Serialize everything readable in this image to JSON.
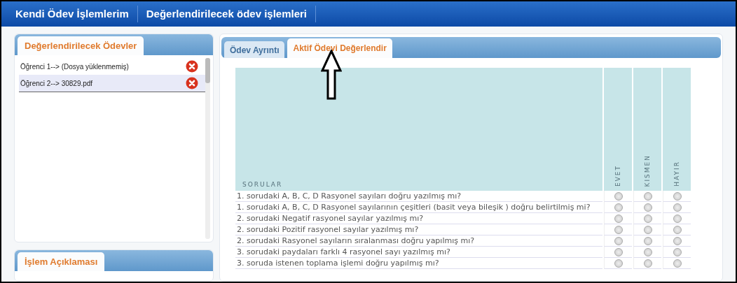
{
  "nav": [
    "Kendi Ödev İşlemlerim",
    "Değerlendirilecek ödev işlemleri"
  ],
  "assignments_panel": {
    "title": "Değerlendirilecek Ödevler",
    "items": [
      {
        "label": "Öğrenci 1--> (Dosya yüklenmemiş)",
        "selected": false
      },
      {
        "label": "Öğrenci 2--> 30829.pdf",
        "selected": true
      }
    ]
  },
  "description_panel": {
    "title": "İşlem Açıklaması"
  },
  "tabs": [
    {
      "label": "Ödev Ayrıntı",
      "selected": false
    },
    {
      "label": "Aktif Ödevi Değerlendir",
      "selected": true
    }
  ],
  "table": {
    "columns": [
      "SORULAR",
      "EVET",
      "KISMEN",
      "HAYIR"
    ],
    "rows": [
      {
        "question": "1. sorudaki A, B, C, D Rasyonel sayıları doğru yazılmış mı?",
        "choices": [
          {
            "selected": false
          },
          {
            "selected": false
          },
          {
            "selected": false
          }
        ]
      },
      {
        "question": "1. sorudaki A, B, C, D Rasyonel sayılarının çeşitleri (basit veya bileşik ) doğru belirtilmiş mi?",
        "choices": [
          {
            "selected": false
          },
          {
            "selected": false
          },
          {
            "selected": false
          }
        ]
      },
      {
        "question": "2. sorudaki Negatif rasyonel sayılar yazılmış mı?",
        "choices": [
          {
            "selected": false
          },
          {
            "selected": false
          },
          {
            "selected": false
          }
        ]
      },
      {
        "question": "2. sorudaki Pozitif rasyonel sayılar yazılmış mı?",
        "choices": [
          {
            "selected": false
          },
          {
            "selected": false
          },
          {
            "selected": false
          }
        ]
      },
      {
        "question": "2. sorudaki Rasyonel sayıların sıralanması doğru yapılmış mı?",
        "choices": [
          {
            "selected": false
          },
          {
            "selected": false
          },
          {
            "selected": false
          }
        ]
      },
      {
        "question": "3. sorudaki paydaları farklı 4 rasyonel sayı yazılmış mı?",
        "choices": [
          {
            "selected": false
          },
          {
            "selected": false
          },
          {
            "selected": false
          }
        ]
      },
      {
        "question": "3. soruda istenen toplama işlemi doğru yapılmış mı?",
        "choices": [
          {
            "selected": false
          },
          {
            "selected": false
          },
          {
            "selected": false
          }
        ]
      }
    ]
  }
}
